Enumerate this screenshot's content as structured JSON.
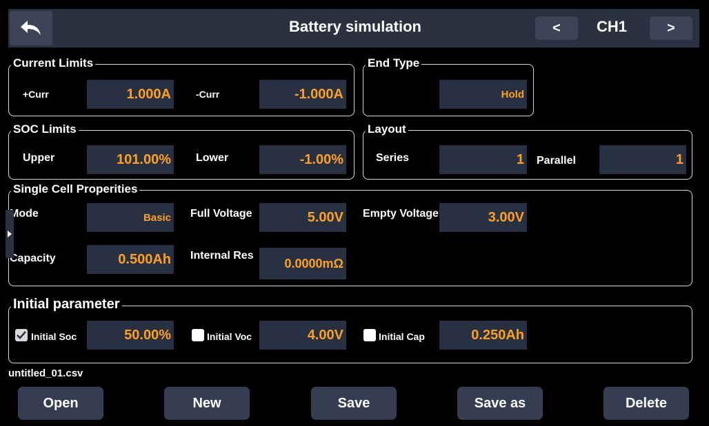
{
  "header": {
    "title": "Battery simulation",
    "channel": "CH1",
    "prev_label": "<",
    "next_label": ">"
  },
  "current_limits": {
    "title": "Current Limits",
    "plus_label": "+Curr",
    "plus_value": "1.000A",
    "minus_label": "-Curr",
    "minus_value": "-1.000A"
  },
  "end_type": {
    "title": "End Type",
    "value": "Hold"
  },
  "soc_limits": {
    "title": "SOC Limits",
    "upper_label": "Upper",
    "upper_value": "101.00%",
    "lower_label": "Lower",
    "lower_value": "-1.00%"
  },
  "layout": {
    "title": "Layout",
    "series_label": "Series",
    "series_value": "1",
    "parallel_label": "Parallel",
    "parallel_value": "1"
  },
  "cell": {
    "title": "Single Cell Properities",
    "mode_label": "Mode",
    "mode_value": "Basic",
    "full_label": "Full Voltage",
    "full_value": "5.00V",
    "empty_label": "Empty Voltage",
    "empty_value": "3.00V",
    "capacity_label": "Capacity",
    "capacity_value": "0.500Ah",
    "res_label": "Internal Res",
    "res_value": "0.0000mΩ"
  },
  "initial": {
    "title": "Initial parameter",
    "soc_label": "Initial Soc",
    "soc_value": "50.00%",
    "soc_checked": true,
    "voc_label": "Initial Voc",
    "voc_value": "4.00V",
    "voc_checked": false,
    "cap_label": "Initial Cap",
    "cap_value": "0.250Ah",
    "cap_checked": false
  },
  "file": {
    "name": "untitled_01.csv"
  },
  "buttons": {
    "open": "Open",
    "new": "New",
    "save": "Save",
    "save_as": "Save as",
    "delete": "Delete"
  },
  "colors": {
    "value": "#ff9f20",
    "field_bg": "#283142",
    "header_bg": "#2b3140"
  }
}
